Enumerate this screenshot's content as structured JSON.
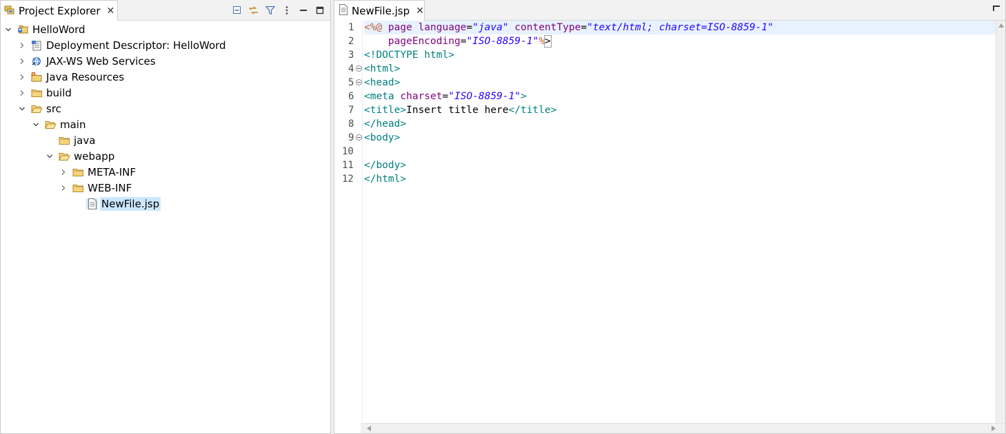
{
  "explorer": {
    "title": "Project Explorer",
    "close_glyph": "✕",
    "toolbar": [
      "collapse-all-icon",
      "link-with-editor-icon",
      "filter-icon",
      "view-menu-icon",
      "minimize-icon",
      "maximize-icon"
    ],
    "tree": [
      {
        "label": "HelloWord",
        "depth": 0,
        "expander": "expanded",
        "icon": "project-icon"
      },
      {
        "label": "Deployment Descriptor: HelloWord",
        "depth": 1,
        "expander": "collapsed",
        "icon": "deployment-descriptor-icon"
      },
      {
        "label": "JAX-WS Web Services",
        "depth": 1,
        "expander": "collapsed",
        "icon": "web-services-icon"
      },
      {
        "label": "Java Resources",
        "depth": 1,
        "expander": "collapsed",
        "icon": "java-resources-icon"
      },
      {
        "label": "build",
        "depth": 1,
        "expander": "collapsed",
        "icon": "folder-icon"
      },
      {
        "label": "src",
        "depth": 1,
        "expander": "expanded",
        "icon": "folder-open-icon"
      },
      {
        "label": "main",
        "depth": 2,
        "expander": "expanded",
        "icon": "folder-open-icon"
      },
      {
        "label": "java",
        "depth": 3,
        "expander": "none",
        "icon": "folder-icon"
      },
      {
        "label": "webapp",
        "depth": 3,
        "expander": "expanded",
        "icon": "folder-open-icon"
      },
      {
        "label": "META-INF",
        "depth": 4,
        "expander": "collapsed",
        "icon": "folder-icon"
      },
      {
        "label": "WEB-INF",
        "depth": 4,
        "expander": "collapsed",
        "icon": "folder-icon"
      },
      {
        "label": "NewFile.jsp",
        "depth": 5,
        "expander": "none",
        "icon": "jsp-file-icon",
        "selected": true
      }
    ]
  },
  "editor": {
    "tab_label": "NewFile.jsp",
    "close_glyph": "✕",
    "current_line": 1,
    "lines": [
      {
        "n": "1",
        "fold": false,
        "tokens": [
          [
            "jsp",
            "<%@ "
          ],
          [
            "attr",
            "page "
          ],
          [
            "attr",
            "language"
          ],
          [
            "eq",
            "="
          ],
          [
            "val",
            "\"java\""
          ],
          [
            "eq",
            " "
          ],
          [
            "attr",
            "contentType"
          ],
          [
            "eq",
            "="
          ],
          [
            "val",
            "\"text/html; charset=ISO-8859-1\""
          ]
        ]
      },
      {
        "n": "2",
        "fold": false,
        "tokens": [
          [
            "eq",
            "    "
          ],
          [
            "attr",
            "pageEncoding"
          ],
          [
            "eq",
            "="
          ],
          [
            "val",
            "\"ISO-8859-1\""
          ],
          [
            "jsp",
            "%"
          ],
          [
            "bracket",
            ">"
          ]
        ]
      },
      {
        "n": "3",
        "fold": false,
        "tokens": [
          [
            "doc",
            "<!DOCTYPE html>"
          ]
        ]
      },
      {
        "n": "4",
        "fold": true,
        "tokens": [
          [
            "tagdel",
            "<html>"
          ]
        ]
      },
      {
        "n": "5",
        "fold": true,
        "tokens": [
          [
            "tagdel",
            "<head>"
          ]
        ]
      },
      {
        "n": "6",
        "fold": false,
        "tokens": [
          [
            "tagdel",
            "<meta "
          ],
          [
            "attr",
            "charset"
          ],
          [
            "eq",
            "="
          ],
          [
            "val",
            "\"ISO-8859-1\""
          ],
          [
            "tagdel",
            ">"
          ]
        ]
      },
      {
        "n": "7",
        "fold": false,
        "tokens": [
          [
            "tagdel",
            "<title>"
          ],
          [
            "text",
            "Insert title here"
          ],
          [
            "tagdel",
            "</title>"
          ]
        ]
      },
      {
        "n": "8",
        "fold": false,
        "tokens": [
          [
            "tagdel",
            "</head>"
          ]
        ]
      },
      {
        "n": "9",
        "fold": true,
        "tokens": [
          [
            "tagdel",
            "<body>"
          ]
        ]
      },
      {
        "n": "10",
        "fold": false,
        "tokens": []
      },
      {
        "n": "11",
        "fold": false,
        "tokens": [
          [
            "tagdel",
            "</body>"
          ]
        ]
      },
      {
        "n": "12",
        "fold": false,
        "tokens": [
          [
            "tagdel",
            "</html>"
          ]
        ]
      }
    ]
  }
}
